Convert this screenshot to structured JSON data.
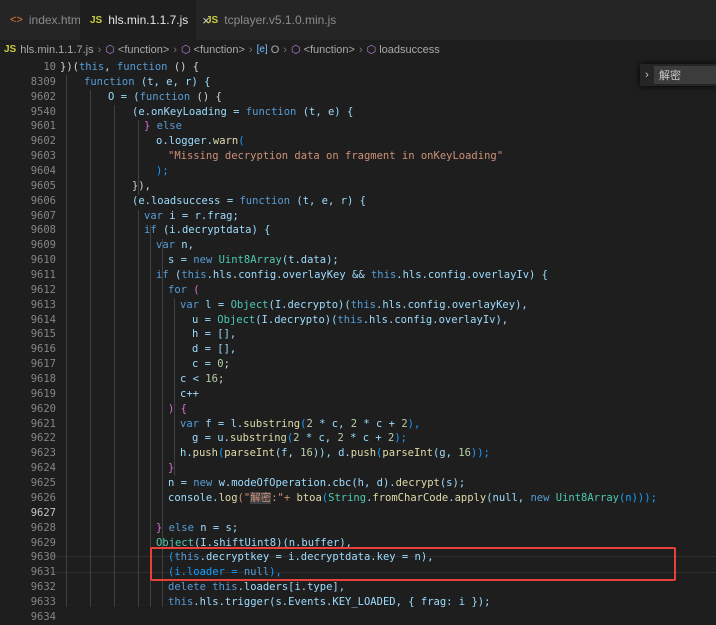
{
  "tabs": [
    {
      "label": "index.html",
      "icon": "html-file-icon"
    },
    {
      "label": "hls.min.1.1.7.js",
      "icon": "js-file-icon",
      "badge": "JS",
      "active": true
    },
    {
      "label": "tcplayer.v5.1.0.min.js",
      "icon": "js-file-icon",
      "badge": "JS"
    }
  ],
  "breadcrumb": {
    "file_badge": "JS",
    "file": "hls.min.1.1.7.js",
    "items": [
      "<function>",
      "<function>",
      "O",
      "<function>",
      "loadsuccess"
    ]
  },
  "find_widget": {
    "value": "解密",
    "chevron": "›"
  },
  "line_numbers": [
    "10",
    "8309",
    "9602",
    "9540",
    "9601",
    "9602",
    "9603",
    "9604",
    "9605",
    "9606",
    "9607",
    "9608",
    "9609",
    "9610",
    "9611",
    "9612",
    "9613",
    "9614",
    "9615",
    "9616",
    "9617",
    "9618",
    "9619",
    "9620",
    "9621",
    "9622",
    "9623",
    "9624",
    "9625",
    "9626",
    "9627",
    "9628",
    "9629",
    "9630",
    "9631",
    "9632",
    "9633",
    "9634"
  ],
  "current_line": "9627",
  "code": {
    "l0a": "})(",
    "l0b": "this",
    "l0c": ", ",
    "l0d": "function",
    "l0e": " () {",
    "l1a": "function",
    "l1b": " (t, e, r) {",
    "l2a": "O = (",
    "l2b": "function",
    "l2c": " () {",
    "l3a": "(e.onKeyLoading = ",
    "l3b": "function",
    "l3c": " (t, e) {",
    "l4a": "} ",
    "l4b": "else",
    "l5a": "o.logger.",
    "l5b": "warn",
    "l5c": "(",
    "l6a": "\"Missing decryption data on fragment in onKeyLoading\"",
    "l7a": ");",
    "l8a": "}),",
    "l9a": "(e.loadsuccess = ",
    "l9b": "function",
    "l9c": " (t, e, r) {",
    "l10a": "var",
    "l10b": " i = r.frag;",
    "l11a": "if",
    "l11b": " (i.decryptdata) {",
    "l12a": "var",
    "l12b": " n,",
    "l13a": "s = ",
    "l13b": "new",
    "l13c": " Uint8Array",
    "l13d": "(t.data);",
    "l14a": "if",
    "l14b": " (",
    "l14c": "this",
    "l14d": ".hls.config.overlayKey && ",
    "l14e": "this",
    "l14f": ".hls.config.overlayIv) {",
    "l15a": "for",
    "l15b": " (",
    "l16a": "var",
    "l16b": " l = ",
    "l16c": "Object",
    "l16d": "(I.decrypto)(",
    "l16e": "this",
    "l16f": ".hls.config.overlayKey),",
    "l17a": "u = ",
    "l17b": "Object",
    "l17c": "(I.decrypto)(",
    "l17d": "this",
    "l17e": ".hls.config.overlayIv),",
    "l18a": "h = [],",
    "l19a": "d = [],",
    "l20a": "c = ",
    "l20b": "0",
    "l20c": ";",
    "l21a": "c < ",
    "l21b": "16",
    "l21c": ";",
    "l22a": "c++",
    "l23a": ") {",
    "l24a": "var",
    "l24b": " f = l.",
    "l24c": "substring",
    "l24d": "(",
    "l24e": "2",
    "l24f": " * c, ",
    "l24g": "2",
    "l24h": " * c + ",
    "l24i": "2",
    "l24j": "),",
    "l25a": "g = u.",
    "l25b": "substring",
    "l25c": "(",
    "l25d": "2",
    "l25e": " * c, ",
    "l25f": "2",
    "l25g": " * c + ",
    "l25h": "2",
    "l25i": ");",
    "l26a": "h.",
    "l26b": "push",
    "l26c": "(",
    "l26d": "parseInt",
    "l26e": "(f, ",
    "l26f": "16",
    "l26g": ")), d.",
    "l26h": "push",
    "l26i": "(",
    "l26j": "parseInt",
    "l26k": "(g, ",
    "l26l": "16",
    "l26m": "));",
    "l27a": "}",
    "l28a": "n = ",
    "l28b": "new",
    "l28c": " w.modeOfOperation.cbc(h, d).",
    "l28d": "decrypt",
    "l28e": "(s);",
    "l29a": "console.",
    "l29b": "log",
    "l29c": "(\"",
    "l29d": "解密",
    "l29e": ":\"+ ",
    "l29f": "btoa",
    "l29g": "(",
    "l29h": "String",
    "l29i": ".",
    "l29j": "fromCharCode",
    "l29k": ".",
    "l29l": "apply",
    "l29m": "(null, ",
    "l29n": "new",
    "l29o": " Uint8Array",
    "l29p": "(n)));",
    "l31a": "} ",
    "l31b": "else",
    "l31c": " n = s;",
    "l32a": "Object",
    "l32b": "(I.shiftUint8)(n.buffer),",
    "l33a": "(",
    "l33b": "this",
    "l33c": ".decryptkey = i.decryptdata.key = n),",
    "l34a": "(i.loader = ",
    "l34b": "null",
    "l34c": "),",
    "l35a": "delete",
    "l35b": " ",
    "l35c": "this",
    "l35d": ".loaders[i.type],",
    "l36a": "this",
    "l36b": ".hls.trigger(s.Events.KEY_LOADED, { frag: i });"
  },
  "colors": {
    "highlight_box": "#e8403a",
    "background": "#1e1e1e"
  }
}
